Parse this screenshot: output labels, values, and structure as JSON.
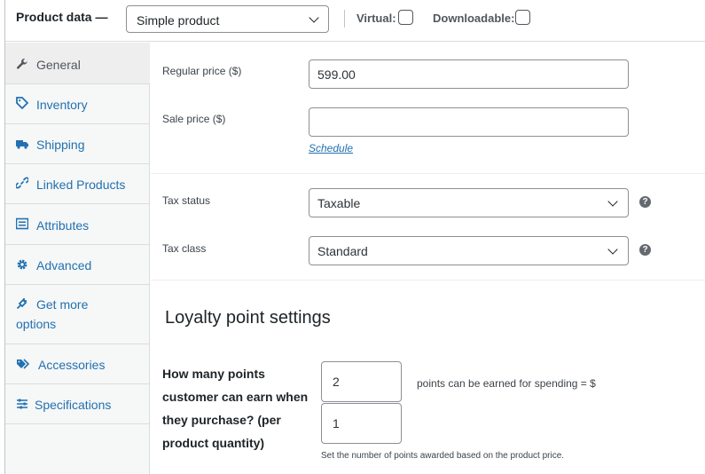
{
  "header": {
    "title": "Product data —",
    "product_type": "Simple product",
    "virtual_label": "Virtual:",
    "downloadable_label": "Downloadable:"
  },
  "tabs": [
    {
      "label": "General",
      "icon": "wrench-icon"
    },
    {
      "label": "Inventory",
      "icon": "tag-icon"
    },
    {
      "label": "Shipping",
      "icon": "truck-icon"
    },
    {
      "label": "Linked Products",
      "icon": "link-icon"
    },
    {
      "label": "Attributes",
      "icon": "list-icon"
    },
    {
      "label": "Advanced",
      "icon": "gear-icon"
    },
    {
      "label": "Get more options",
      "icon": "plugin-icon"
    },
    {
      "label": "Accessories",
      "icon": "tags-icon"
    },
    {
      "label": "Specifications",
      "icon": "sliders-icon"
    }
  ],
  "pricing": {
    "regular_label": "Regular price ($)",
    "regular_value": "599.00",
    "sale_label": "Sale price ($)",
    "sale_value": "",
    "schedule_link": "Schedule"
  },
  "tax": {
    "status_label": "Tax status",
    "status_value": "Taxable",
    "class_label": "Tax class",
    "class_value": "Standard",
    "help_glyph": "?"
  },
  "loyalty": {
    "title": "Loyalty point settings",
    "question": "How many points customer can earn when they purchase? (per product quantity)",
    "points_value": "2",
    "spend_value": "1",
    "inline_note": "points can be earned for spending  = $",
    "description": "Set the number of points awarded based on the product price."
  }
}
